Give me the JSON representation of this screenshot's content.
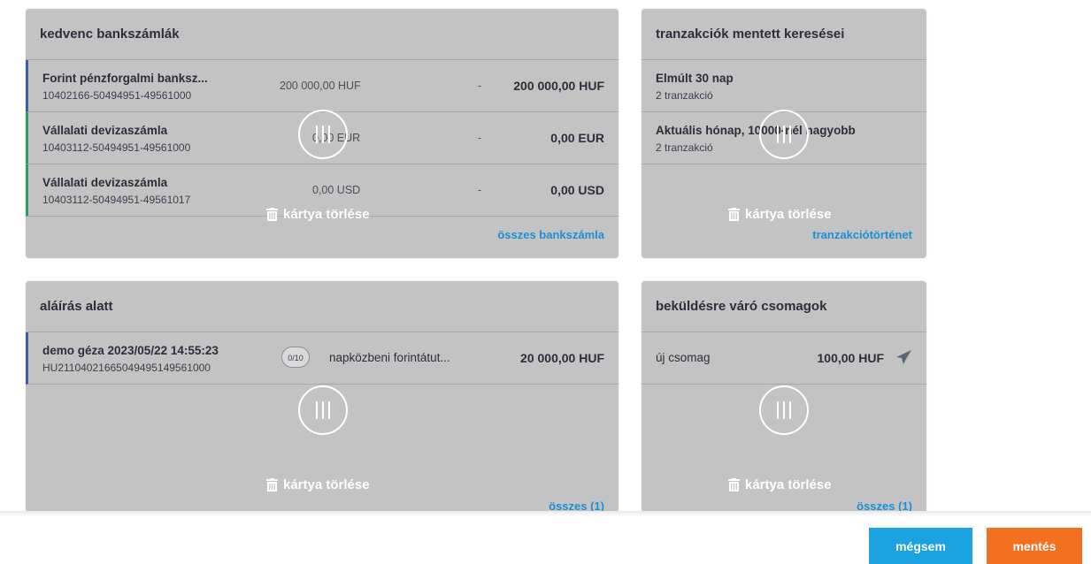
{
  "cards": {
    "accounts": {
      "title": "kedvenc bankszámlák",
      "rows": [
        {
          "name": "Forint pénzforgalmi banksz...",
          "number": "10402166-50494951-49561000",
          "balance": "200 000,00 HUF",
          "dash": "-",
          "available": "200 000,00 HUF"
        },
        {
          "name": "Vállalati devizaszámla",
          "number": "10403112-50494951-49561000",
          "balance": "0,00 EUR",
          "dash": "-",
          "available": "0,00 EUR"
        },
        {
          "name": "Vállalati devizaszámla",
          "number": "10403112-50494951-49561017",
          "balance": "0,00 USD",
          "dash": "-",
          "available": "0,00 USD"
        }
      ],
      "delete_label": "kártya törlése",
      "link_label": "összes bankszámla"
    },
    "saved_searches": {
      "title": "tranzakciók mentett keresései",
      "rows": [
        {
          "name": "Elmúlt 30 nap",
          "sub": "2 tranzakció"
        },
        {
          "name": "Aktuális hónap, 10000-nél nagyobb",
          "sub": "2 tranzakció"
        }
      ],
      "delete_label": "kártya törlése",
      "link_label": "tranzakciótörténet"
    },
    "signing": {
      "title": "aláírás alatt",
      "rows": [
        {
          "name": "demo géza 2023/05/22 14:55:23",
          "number": "HU21104021665049495149561000",
          "badge": "0/10",
          "description": "napközbeni forintátut...",
          "amount": "20 000,00 HUF"
        }
      ],
      "delete_label": "kártya törlése",
      "link_label": "összes (1)"
    },
    "packages": {
      "title": "beküldésre váró csomagok",
      "rows": [
        {
          "name": "új csomag",
          "amount": "100,00 HUF"
        }
      ],
      "delete_label": "kártya törlése",
      "link_label": "összes (1)"
    }
  },
  "footer": {
    "cancel_label": "mégsem",
    "save_label": "mentés"
  },
  "colors": {
    "card_bg": "#c3c3c3",
    "link": "#1a8fd6",
    "cancel_button": "#1aa3e0",
    "save_button": "#f37021",
    "accent_blue": "#3f5ba9",
    "accent_green": "#2f9e6f"
  },
  "icons": {
    "trash": "trash-icon",
    "drag": "drag-handle-icon",
    "send": "paper-plane-icon"
  }
}
